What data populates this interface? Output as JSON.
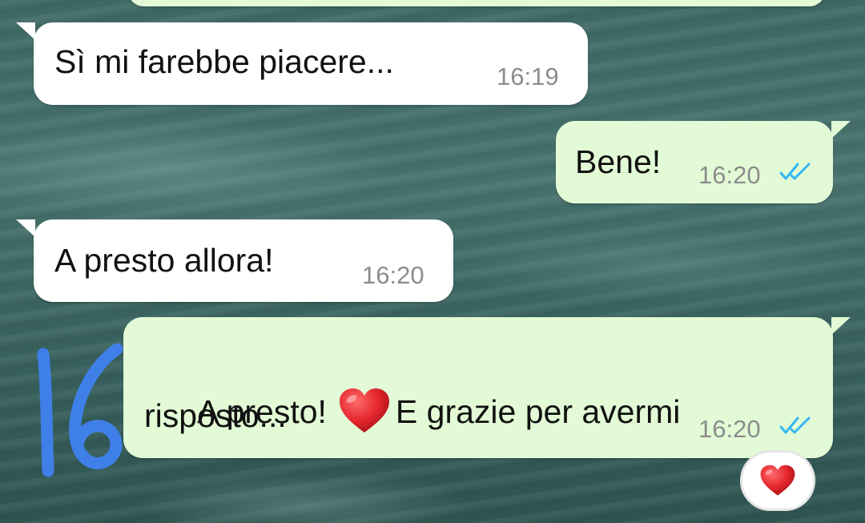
{
  "messages": [
    {
      "direction": "incoming",
      "text": "Sì mi farebbe piacere...",
      "time": "16:19"
    },
    {
      "direction": "outgoing",
      "text": "Bene!",
      "time": "16:20",
      "status": "read",
      "status_color": "#34b7f1"
    },
    {
      "direction": "incoming",
      "text": "A presto allora!",
      "time": "16:20"
    },
    {
      "direction": "outgoing",
      "text_line1_before": "A presto!",
      "emoji": "heart-emoji",
      "text_line1_after": "E grazie per avermi",
      "text_line2": "risposto...",
      "time": "16:20",
      "status": "read",
      "status_color": "#34b7f1",
      "reaction": "heart-emoji"
    }
  ],
  "annotation": {
    "text": "16",
    "color": "#3f7fe8"
  },
  "colors": {
    "incoming_bubble": "#ffffff",
    "outgoing_bubble": "#e2fbd6",
    "time_text": "#8c8c8c",
    "heart": "#e3242b"
  }
}
